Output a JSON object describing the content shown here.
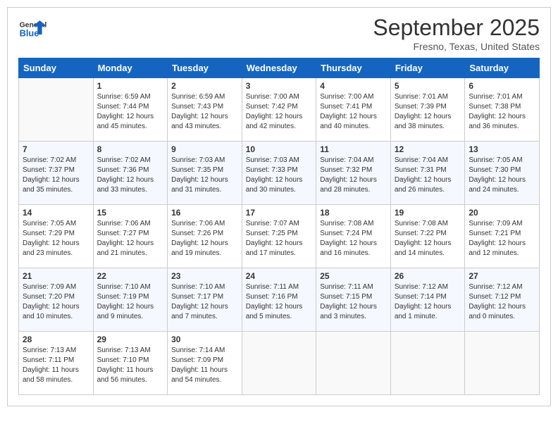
{
  "logo": {
    "general": "General",
    "blue": "Blue"
  },
  "title": "September 2025",
  "location": "Fresno, Texas, United States",
  "days_of_week": [
    "Sunday",
    "Monday",
    "Tuesday",
    "Wednesday",
    "Thursday",
    "Friday",
    "Saturday"
  ],
  "weeks": [
    [
      {
        "num": "",
        "sunrise": "",
        "sunset": "",
        "daylight": "",
        "empty": true
      },
      {
        "num": "1",
        "sunrise": "Sunrise: 6:59 AM",
        "sunset": "Sunset: 7:44 PM",
        "daylight": "Daylight: 12 hours and 45 minutes."
      },
      {
        "num": "2",
        "sunrise": "Sunrise: 6:59 AM",
        "sunset": "Sunset: 7:43 PM",
        "daylight": "Daylight: 12 hours and 43 minutes."
      },
      {
        "num": "3",
        "sunrise": "Sunrise: 7:00 AM",
        "sunset": "Sunset: 7:42 PM",
        "daylight": "Daylight: 12 hours and 42 minutes."
      },
      {
        "num": "4",
        "sunrise": "Sunrise: 7:00 AM",
        "sunset": "Sunset: 7:41 PM",
        "daylight": "Daylight: 12 hours and 40 minutes."
      },
      {
        "num": "5",
        "sunrise": "Sunrise: 7:01 AM",
        "sunset": "Sunset: 7:39 PM",
        "daylight": "Daylight: 12 hours and 38 minutes."
      },
      {
        "num": "6",
        "sunrise": "Sunrise: 7:01 AM",
        "sunset": "Sunset: 7:38 PM",
        "daylight": "Daylight: 12 hours and 36 minutes."
      }
    ],
    [
      {
        "num": "7",
        "sunrise": "Sunrise: 7:02 AM",
        "sunset": "Sunset: 7:37 PM",
        "daylight": "Daylight: 12 hours and 35 minutes."
      },
      {
        "num": "8",
        "sunrise": "Sunrise: 7:02 AM",
        "sunset": "Sunset: 7:36 PM",
        "daylight": "Daylight: 12 hours and 33 minutes."
      },
      {
        "num": "9",
        "sunrise": "Sunrise: 7:03 AM",
        "sunset": "Sunset: 7:35 PM",
        "daylight": "Daylight: 12 hours and 31 minutes."
      },
      {
        "num": "10",
        "sunrise": "Sunrise: 7:03 AM",
        "sunset": "Sunset: 7:33 PM",
        "daylight": "Daylight: 12 hours and 30 minutes."
      },
      {
        "num": "11",
        "sunrise": "Sunrise: 7:04 AM",
        "sunset": "Sunset: 7:32 PM",
        "daylight": "Daylight: 12 hours and 28 minutes."
      },
      {
        "num": "12",
        "sunrise": "Sunrise: 7:04 AM",
        "sunset": "Sunset: 7:31 PM",
        "daylight": "Daylight: 12 hours and 26 minutes."
      },
      {
        "num": "13",
        "sunrise": "Sunrise: 7:05 AM",
        "sunset": "Sunset: 7:30 PM",
        "daylight": "Daylight: 12 hours and 24 minutes."
      }
    ],
    [
      {
        "num": "14",
        "sunrise": "Sunrise: 7:05 AM",
        "sunset": "Sunset: 7:29 PM",
        "daylight": "Daylight: 12 hours and 23 minutes."
      },
      {
        "num": "15",
        "sunrise": "Sunrise: 7:06 AM",
        "sunset": "Sunset: 7:27 PM",
        "daylight": "Daylight: 12 hours and 21 minutes."
      },
      {
        "num": "16",
        "sunrise": "Sunrise: 7:06 AM",
        "sunset": "Sunset: 7:26 PM",
        "daylight": "Daylight: 12 hours and 19 minutes."
      },
      {
        "num": "17",
        "sunrise": "Sunrise: 7:07 AM",
        "sunset": "Sunset: 7:25 PM",
        "daylight": "Daylight: 12 hours and 17 minutes."
      },
      {
        "num": "18",
        "sunrise": "Sunrise: 7:08 AM",
        "sunset": "Sunset: 7:24 PM",
        "daylight": "Daylight: 12 hours and 16 minutes."
      },
      {
        "num": "19",
        "sunrise": "Sunrise: 7:08 AM",
        "sunset": "Sunset: 7:22 PM",
        "daylight": "Daylight: 12 hours and 14 minutes."
      },
      {
        "num": "20",
        "sunrise": "Sunrise: 7:09 AM",
        "sunset": "Sunset: 7:21 PM",
        "daylight": "Daylight: 12 hours and 12 minutes."
      }
    ],
    [
      {
        "num": "21",
        "sunrise": "Sunrise: 7:09 AM",
        "sunset": "Sunset: 7:20 PM",
        "daylight": "Daylight: 12 hours and 10 minutes."
      },
      {
        "num": "22",
        "sunrise": "Sunrise: 7:10 AM",
        "sunset": "Sunset: 7:19 PM",
        "daylight": "Daylight: 12 hours and 9 minutes."
      },
      {
        "num": "23",
        "sunrise": "Sunrise: 7:10 AM",
        "sunset": "Sunset: 7:17 PM",
        "daylight": "Daylight: 12 hours and 7 minutes."
      },
      {
        "num": "24",
        "sunrise": "Sunrise: 7:11 AM",
        "sunset": "Sunset: 7:16 PM",
        "daylight": "Daylight: 12 hours and 5 minutes."
      },
      {
        "num": "25",
        "sunrise": "Sunrise: 7:11 AM",
        "sunset": "Sunset: 7:15 PM",
        "daylight": "Daylight: 12 hours and 3 minutes."
      },
      {
        "num": "26",
        "sunrise": "Sunrise: 7:12 AM",
        "sunset": "Sunset: 7:14 PM",
        "daylight": "Daylight: 12 hours and 1 minute."
      },
      {
        "num": "27",
        "sunrise": "Sunrise: 7:12 AM",
        "sunset": "Sunset: 7:12 PM",
        "daylight": "Daylight: 12 hours and 0 minutes."
      }
    ],
    [
      {
        "num": "28",
        "sunrise": "Sunrise: 7:13 AM",
        "sunset": "Sunset: 7:11 PM",
        "daylight": "Daylight: 11 hours and 58 minutes."
      },
      {
        "num": "29",
        "sunrise": "Sunrise: 7:13 AM",
        "sunset": "Sunset: 7:10 PM",
        "daylight": "Daylight: 11 hours and 56 minutes."
      },
      {
        "num": "30",
        "sunrise": "Sunrise: 7:14 AM",
        "sunset": "Sunset: 7:09 PM",
        "daylight": "Daylight: 11 hours and 54 minutes."
      },
      {
        "num": "",
        "sunrise": "",
        "sunset": "",
        "daylight": "",
        "empty": true
      },
      {
        "num": "",
        "sunrise": "",
        "sunset": "",
        "daylight": "",
        "empty": true
      },
      {
        "num": "",
        "sunrise": "",
        "sunset": "",
        "daylight": "",
        "empty": true
      },
      {
        "num": "",
        "sunrise": "",
        "sunset": "",
        "daylight": "",
        "empty": true
      }
    ]
  ]
}
